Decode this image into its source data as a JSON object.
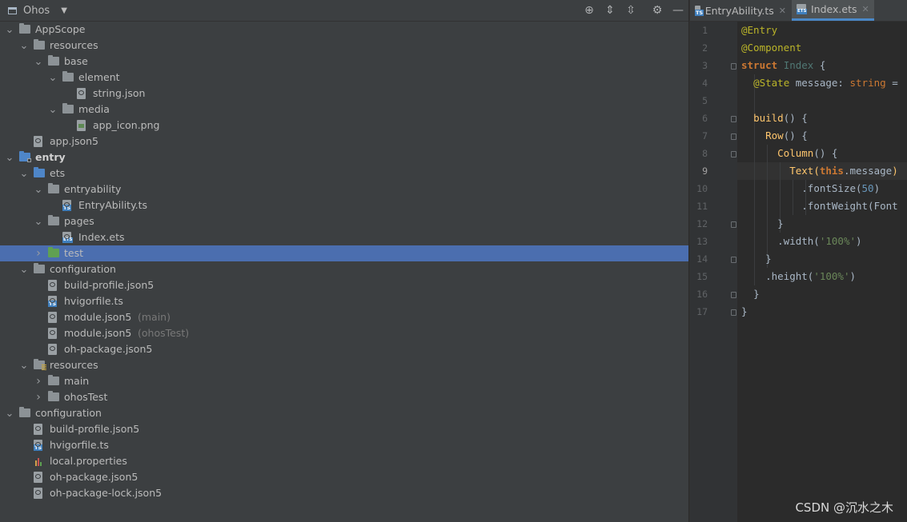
{
  "project_panel": {
    "view_title": "Ohos",
    "tree": [
      {
        "label": "AppScope",
        "icon": "folder-icon",
        "level": 0,
        "arrow": "expanded"
      },
      {
        "label": "resources",
        "icon": "folder-icon",
        "level": 1,
        "arrow": "expanded"
      },
      {
        "label": "base",
        "icon": "folder-icon",
        "level": 2,
        "arrow": "expanded"
      },
      {
        "label": "element",
        "icon": "folder-icon",
        "level": 3,
        "arrow": "expanded"
      },
      {
        "label": "string.json",
        "icon": "json-file-icon",
        "level": 4,
        "arrow": "none"
      },
      {
        "label": "media",
        "icon": "folder-icon",
        "level": 3,
        "arrow": "expanded"
      },
      {
        "label": "app_icon.png",
        "icon": "image-file-icon",
        "level": 4,
        "arrow": "none"
      },
      {
        "label": "app.json5",
        "icon": "json-file-icon",
        "level": 1,
        "arrow": "none"
      },
      {
        "label": "entry",
        "icon": "module-folder-icon",
        "level": 0,
        "arrow": "expanded",
        "bold": true
      },
      {
        "label": "ets",
        "icon": "source-folder-icon",
        "level": 1,
        "arrow": "expanded"
      },
      {
        "label": "entryability",
        "icon": "folder-icon",
        "level": 2,
        "arrow": "expanded"
      },
      {
        "label": "EntryAbility.ts",
        "icon": "ts-file-icon",
        "level": 3,
        "arrow": "none"
      },
      {
        "label": "pages",
        "icon": "folder-icon",
        "level": 2,
        "arrow": "expanded"
      },
      {
        "label": "Index.ets",
        "icon": "ets-file-icon",
        "level": 3,
        "arrow": "none"
      },
      {
        "label": "test",
        "icon": "test-folder-icon",
        "level": 2,
        "arrow": "collapsed",
        "selected": true
      },
      {
        "label": "configuration",
        "icon": "folder-icon",
        "level": 1,
        "arrow": "expanded"
      },
      {
        "label": "build-profile.json5",
        "icon": "json-file-icon",
        "level": 2,
        "arrow": "none"
      },
      {
        "label": "hvigorfile.ts",
        "icon": "ts-file-icon",
        "level": 2,
        "arrow": "none"
      },
      {
        "label": "module.json5",
        "icon": "json-file-icon",
        "level": 2,
        "arrow": "none",
        "hint": "(main)"
      },
      {
        "label": "module.json5",
        "icon": "json-file-icon",
        "level": 2,
        "arrow": "none",
        "hint": "(ohosTest)"
      },
      {
        "label": "oh-package.json5",
        "icon": "json-file-icon",
        "level": 2,
        "arrow": "none"
      },
      {
        "label": "resources",
        "icon": "resources-folder-icon",
        "level": 1,
        "arrow": "expanded"
      },
      {
        "label": "main",
        "icon": "folder-icon",
        "level": 2,
        "arrow": "collapsed"
      },
      {
        "label": "ohosTest",
        "icon": "folder-icon",
        "level": 2,
        "arrow": "collapsed"
      },
      {
        "label": "configuration",
        "icon": "folder-icon",
        "level": 0,
        "arrow": "expanded"
      },
      {
        "label": "build-profile.json5",
        "icon": "json-file-icon",
        "level": 1,
        "arrow": "none"
      },
      {
        "label": "hvigorfile.ts",
        "icon": "ts-file-icon",
        "level": 1,
        "arrow": "none"
      },
      {
        "label": "local.properties",
        "icon": "properties-file-icon",
        "level": 1,
        "arrow": "none"
      },
      {
        "label": "oh-package.json5",
        "icon": "json-file-icon",
        "level": 1,
        "arrow": "none"
      },
      {
        "label": "oh-package-lock.json5",
        "icon": "json-file-icon",
        "level": 1,
        "arrow": "none"
      }
    ]
  },
  "editor": {
    "tabs": [
      {
        "label": "EntryAbility.ts",
        "badge": "TS",
        "active": false
      },
      {
        "label": "Index.ets",
        "badge": "ETS",
        "active": true
      }
    ],
    "current_line": 9,
    "lines": [
      "1",
      "2",
      "3",
      "4",
      "5",
      "6",
      "7",
      "8",
      "9",
      "10",
      "11",
      "12",
      "13",
      "14",
      "15",
      "16",
      "17"
    ],
    "code": {
      "l1": "@Entry",
      "l2": "@Component",
      "l3_kw": "struct",
      "l3_name": "Index",
      "l3_brace": "{",
      "l4_dec": "@State",
      "l4_rest": "message:",
      "l4_type": "string",
      "l4_eq": "=",
      "l6_fn": "build",
      "l6_rest": "() {",
      "l7_fn": "Row",
      "l7_rest": "() {",
      "l8_fn": "Column",
      "l8_rest": "() {",
      "l9_fn": "Text",
      "l9_open": "(",
      "l9_this": "this",
      "l9_rest": ".message",
      "l9_close": ")",
      "l10_m": ".fontSize(",
      "l10_n": "50",
      "l10_c": ")",
      "l11_m": ".fontWeight(Font",
      "l12": "}",
      "l13_m": ".width(",
      "l13_s": "'100%'",
      "l13_c": ")",
      "l14": "}",
      "l15_m": ".height(",
      "l15_s": "'100%'",
      "l15_c": ")",
      "l16": "}",
      "l17": "}"
    }
  },
  "watermark": "CSDN @沉水之木"
}
